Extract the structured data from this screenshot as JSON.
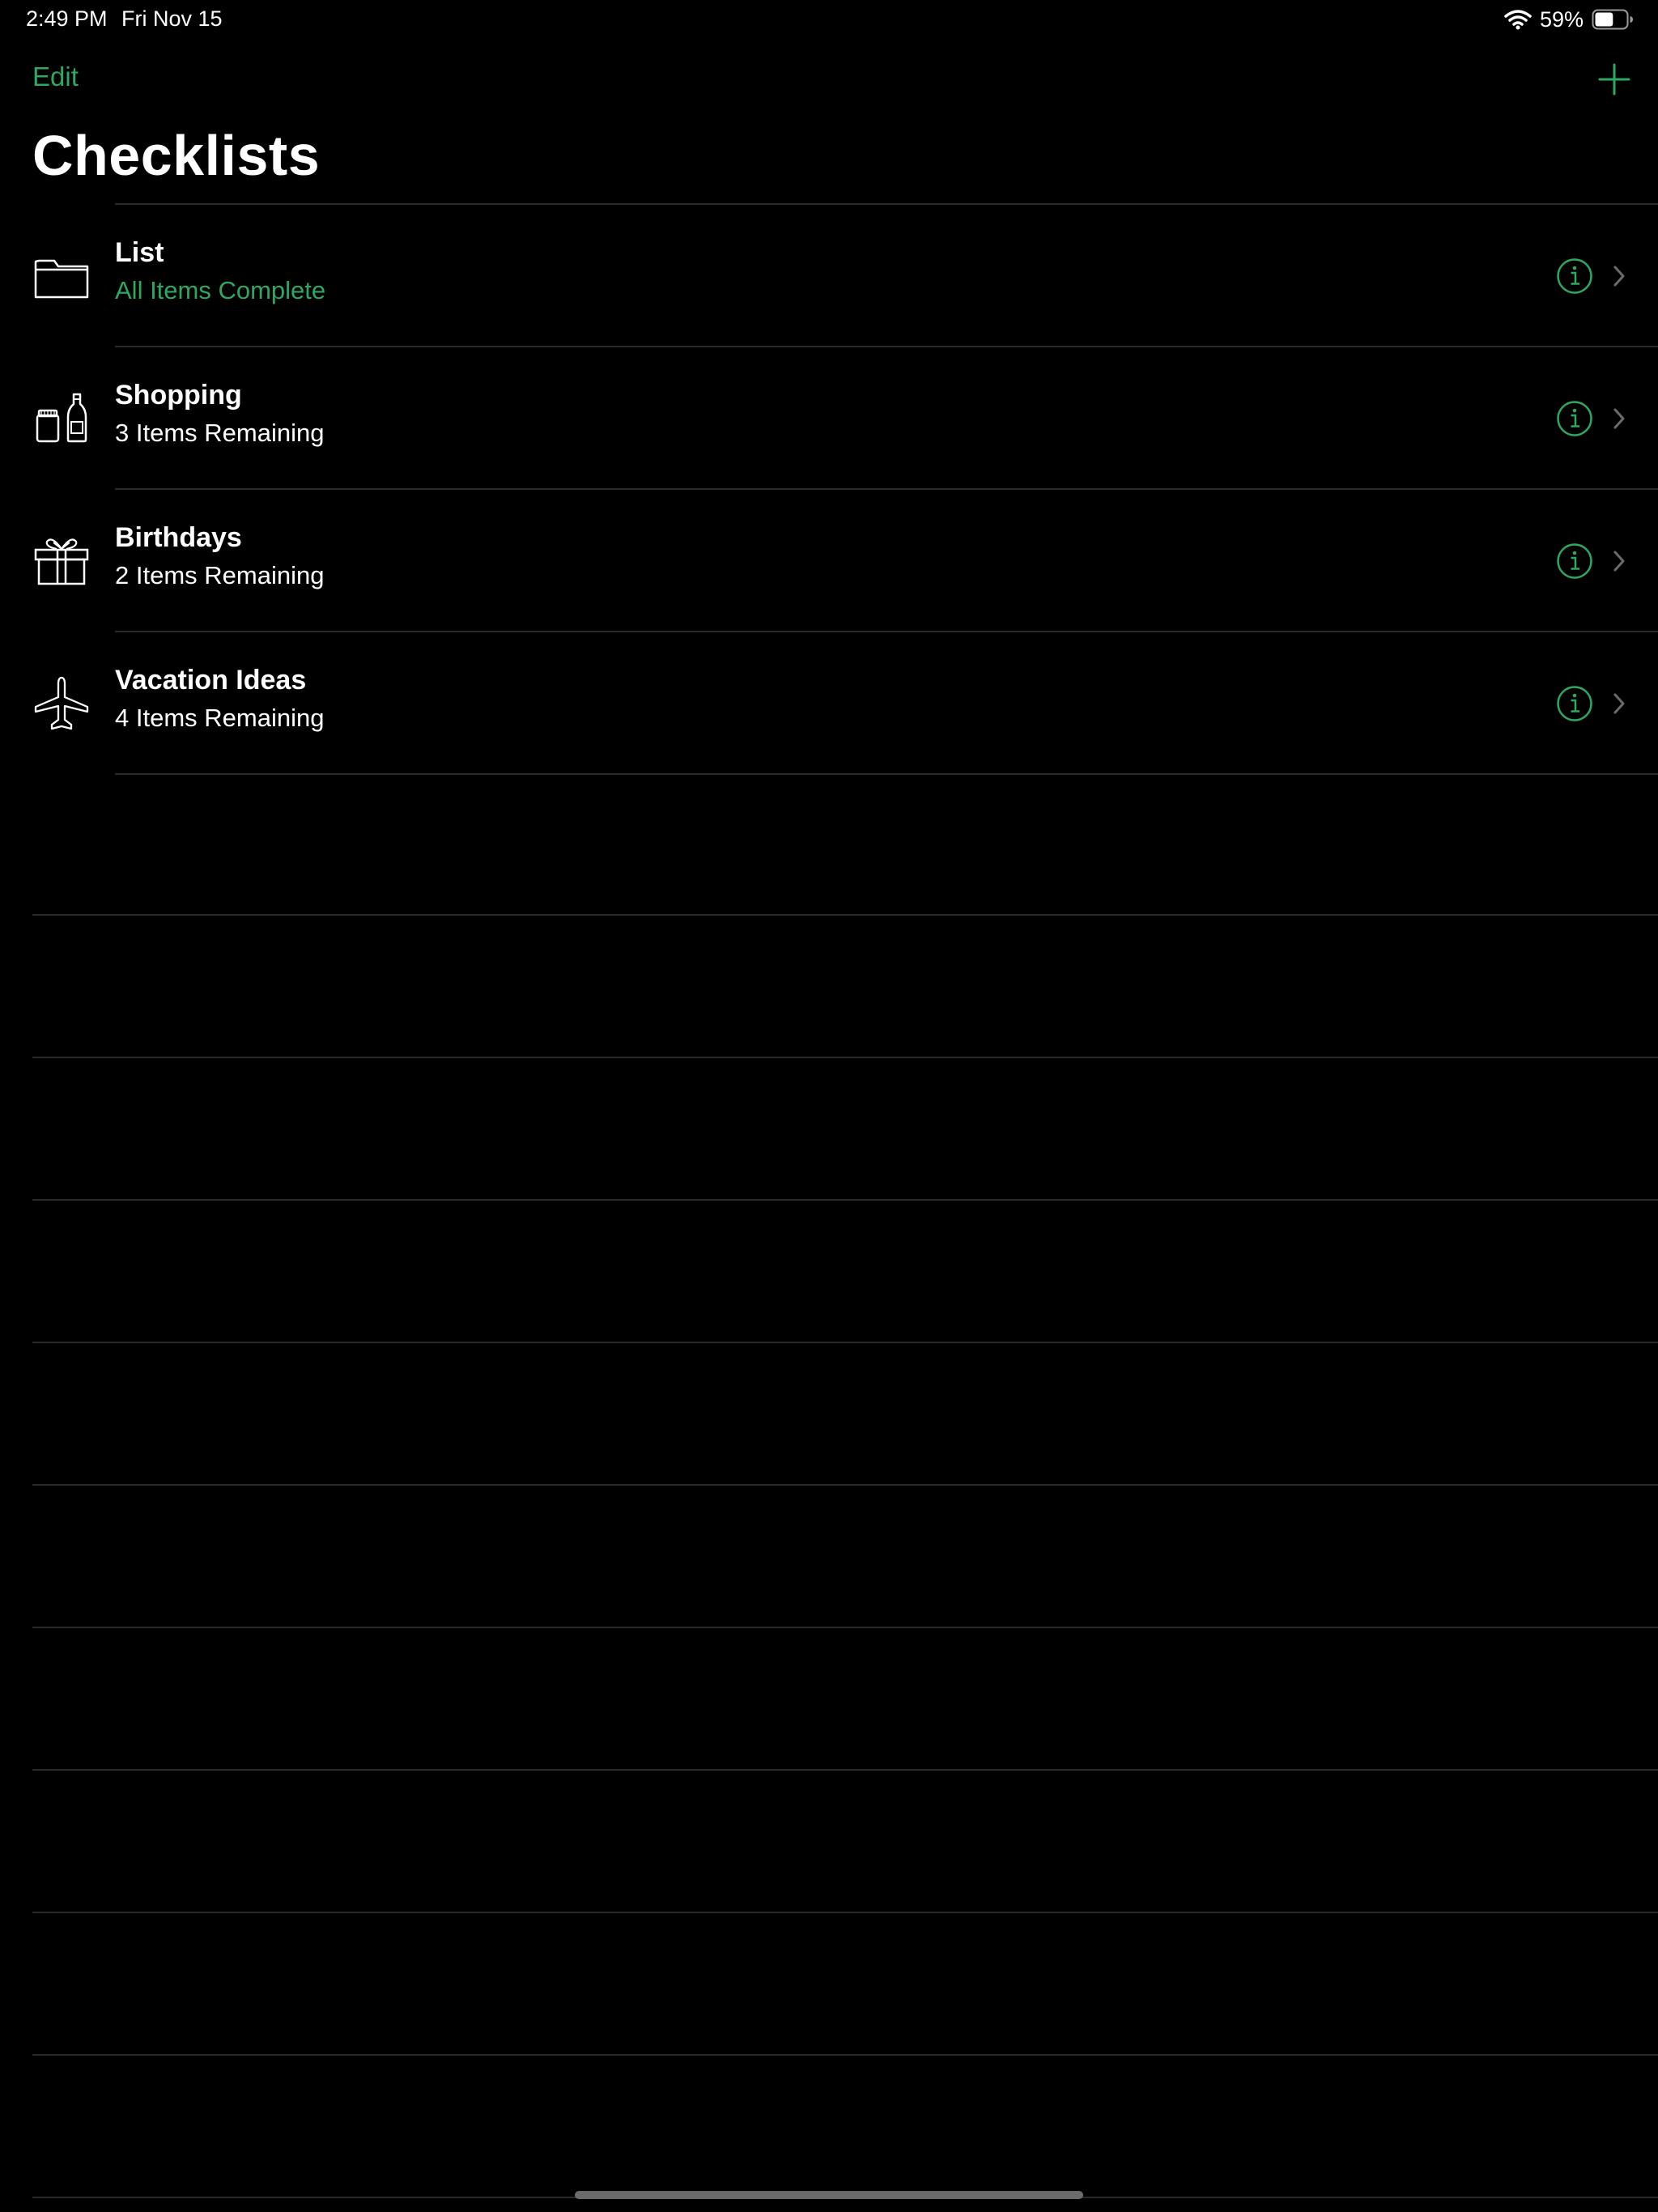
{
  "status_bar": {
    "time": "2:49 PM",
    "date": "Fri Nov 15",
    "battery_percent": "59%",
    "battery_level": 0.59,
    "icons": [
      "wifi-icon",
      "battery-icon"
    ]
  },
  "nav": {
    "edit_label": "Edit",
    "add_icon": "plus-icon"
  },
  "title": "Checklists",
  "colors": {
    "accent": "#2ea763",
    "background": "#000000",
    "separator": "#2a2a2a",
    "chevron": "#6b6b6b"
  },
  "checklists": [
    {
      "icon": "folder-icon",
      "title": "List",
      "subtitle": "All Items Complete",
      "complete": true
    },
    {
      "icon": "shopping-icon",
      "title": "Shopping",
      "subtitle": "3 Items Remaining",
      "complete": false
    },
    {
      "icon": "gift-icon",
      "title": "Birthdays",
      "subtitle": "2 Items Remaining",
      "complete": false
    },
    {
      "icon": "airplane-icon",
      "title": "Vacation Ideas",
      "subtitle": "4 Items Remaining",
      "complete": false
    }
  ]
}
